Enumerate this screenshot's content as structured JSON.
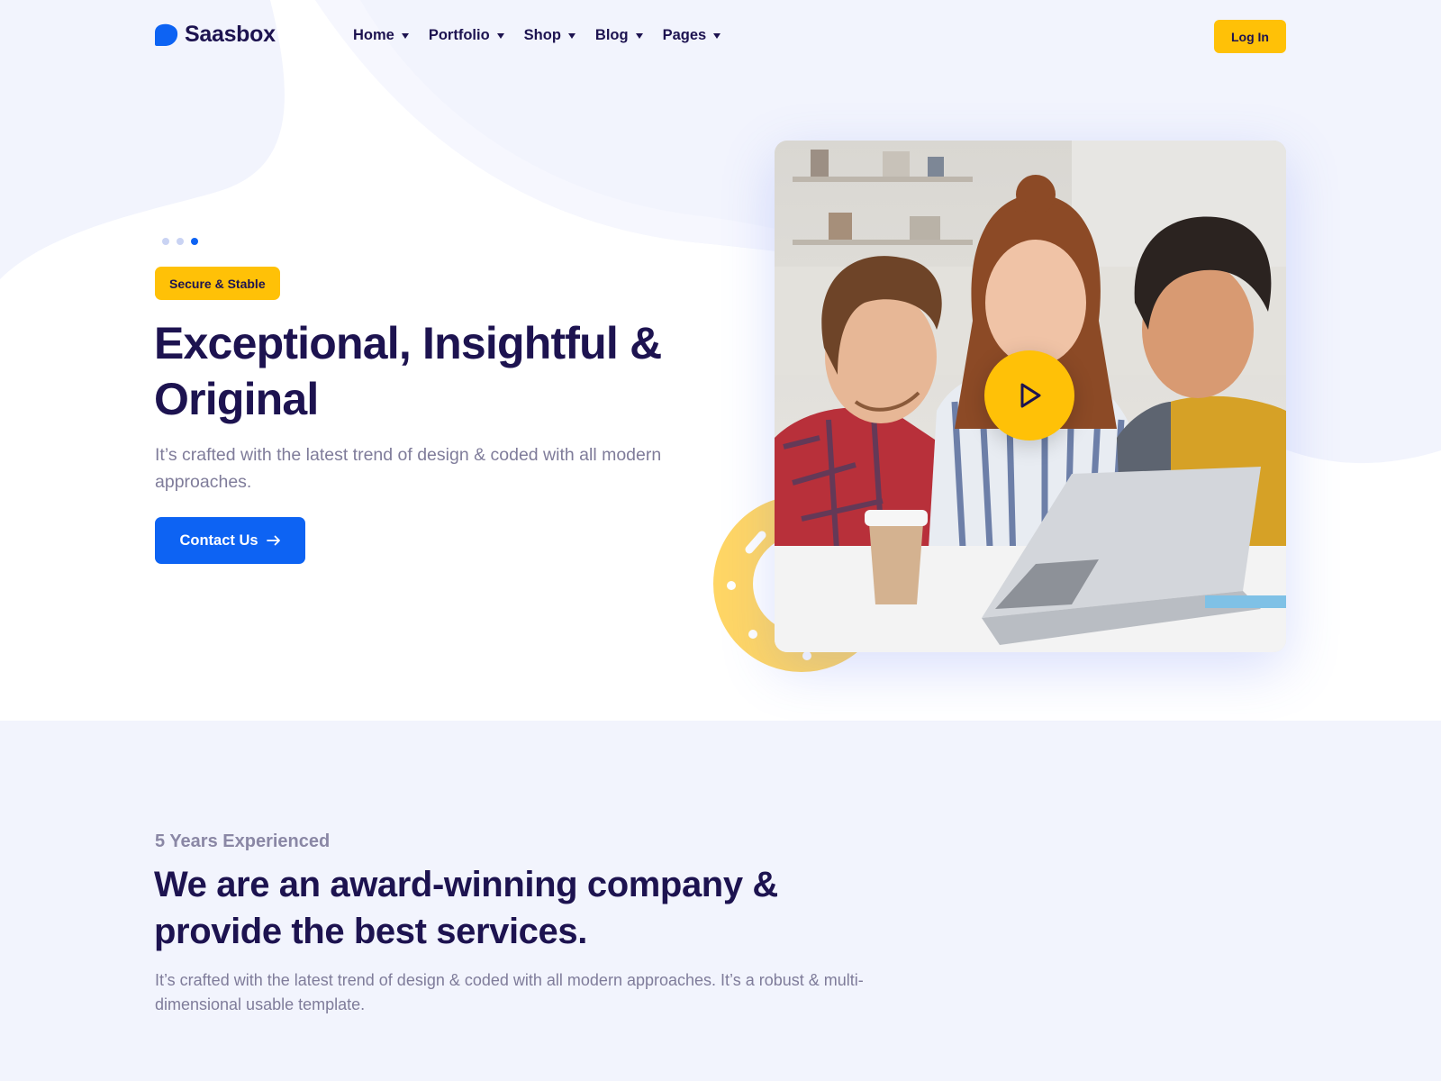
{
  "brand": {
    "name": "Saasbox"
  },
  "nav": {
    "items": [
      {
        "label": "Home"
      },
      {
        "label": "Portfolio"
      },
      {
        "label": "Shop"
      },
      {
        "label": "Blog"
      },
      {
        "label": "Pages"
      }
    ],
    "login_label": "Log In"
  },
  "hero": {
    "slider_dots": 3,
    "active_dot": 3,
    "badge": "Secure & Stable",
    "title": "Exceptional, Insightful & Original",
    "subtitle": "It’s crafted with the latest trend of design & coded with all modern approaches.",
    "cta_label": "Contact Us",
    "media_icon": "play-icon"
  },
  "about": {
    "kicker": "5 Years Experienced",
    "title": "We are an award-winning company & provide the best services.",
    "text": "It’s crafted with the latest trend of design & coded with all modern approaches. It’s a robust & multi-dimensional usable template."
  },
  "colors": {
    "primary": "#0d63f3",
    "accent": "#ffc107",
    "heading": "#1d1350",
    "muted": "#7f7c9a",
    "background": "#f2f4fd"
  }
}
